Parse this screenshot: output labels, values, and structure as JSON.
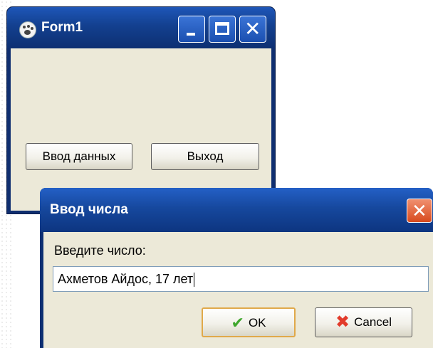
{
  "form1": {
    "title": "Form1",
    "buttons": {
      "input_label": "Ввод данных",
      "exit_label": "Выход"
    }
  },
  "dialog": {
    "title": "Ввод числа",
    "prompt": "Введите число:",
    "input_value": "Ахметов Айдос, 17 лет",
    "ok_label": "OK",
    "cancel_label": "Cancel"
  },
  "icons": {
    "app": "paw-icon",
    "minimize": "minimize-icon",
    "maximize": "maximize-icon",
    "close": "close-icon",
    "ok": "checkmark-icon",
    "cancel": "x-icon"
  },
  "colors": {
    "titlebar": "#1b4fb0",
    "client": "#ece9d8",
    "dialog_close": "#d84a1e"
  }
}
